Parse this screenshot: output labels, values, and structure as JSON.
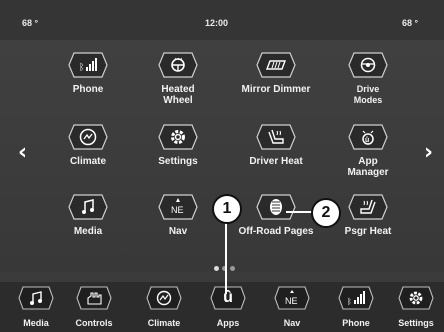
{
  "status": {
    "left_temp": "68 °",
    "time": "12:00",
    "right_temp": "68 °"
  },
  "apps": [
    {
      "label": "Phone",
      "icon": "phone-signal-icon"
    },
    {
      "label": "Heated\nWheel",
      "icon": "heated-wheel-icon"
    },
    {
      "label": "Mirror Dimmer",
      "icon": "mirror-dimmer-icon"
    },
    {
      "label": "Drive\nModes",
      "icon": "drive-modes-icon"
    },
    {
      "label": "Climate",
      "icon": "climate-icon"
    },
    {
      "label": "Settings",
      "icon": "gear-icon"
    },
    {
      "label": "Driver Heat",
      "icon": "driver-seat-heat-icon"
    },
    {
      "label": "App\nManager",
      "icon": "app-manager-icon"
    },
    {
      "label": "Media",
      "icon": "music-note-icon"
    },
    {
      "label": "Nav",
      "icon": "compass-ne-icon",
      "glyph": "NE"
    },
    {
      "label": "Off-Road Pages",
      "icon": "tire-icon"
    },
    {
      "label": "Psgr Heat",
      "icon": "passenger-seat-heat-icon"
    }
  ],
  "dock": [
    {
      "label": "Media",
      "icon": "music-note-icon"
    },
    {
      "label": "Controls",
      "icon": "controls-hand-icon"
    },
    {
      "label": "Climate",
      "icon": "climate-icon"
    },
    {
      "label": "Apps",
      "icon": "apps-u-icon",
      "glyph": "û"
    },
    {
      "label": "Nav",
      "icon": "compass-ne-icon",
      "glyph": "NE"
    },
    {
      "label": "Phone",
      "icon": "phone-signal-icon"
    },
    {
      "label": "Settings",
      "icon": "gear-icon"
    }
  ],
  "arrows": {
    "left": "‹",
    "right": "›"
  },
  "callouts": {
    "one": "1",
    "two": "2"
  },
  "colors": {
    "background": "#3b3b3b",
    "dock": "#2c2c2c",
    "text": "#ffffff",
    "callout_fill": "#ffffff"
  }
}
